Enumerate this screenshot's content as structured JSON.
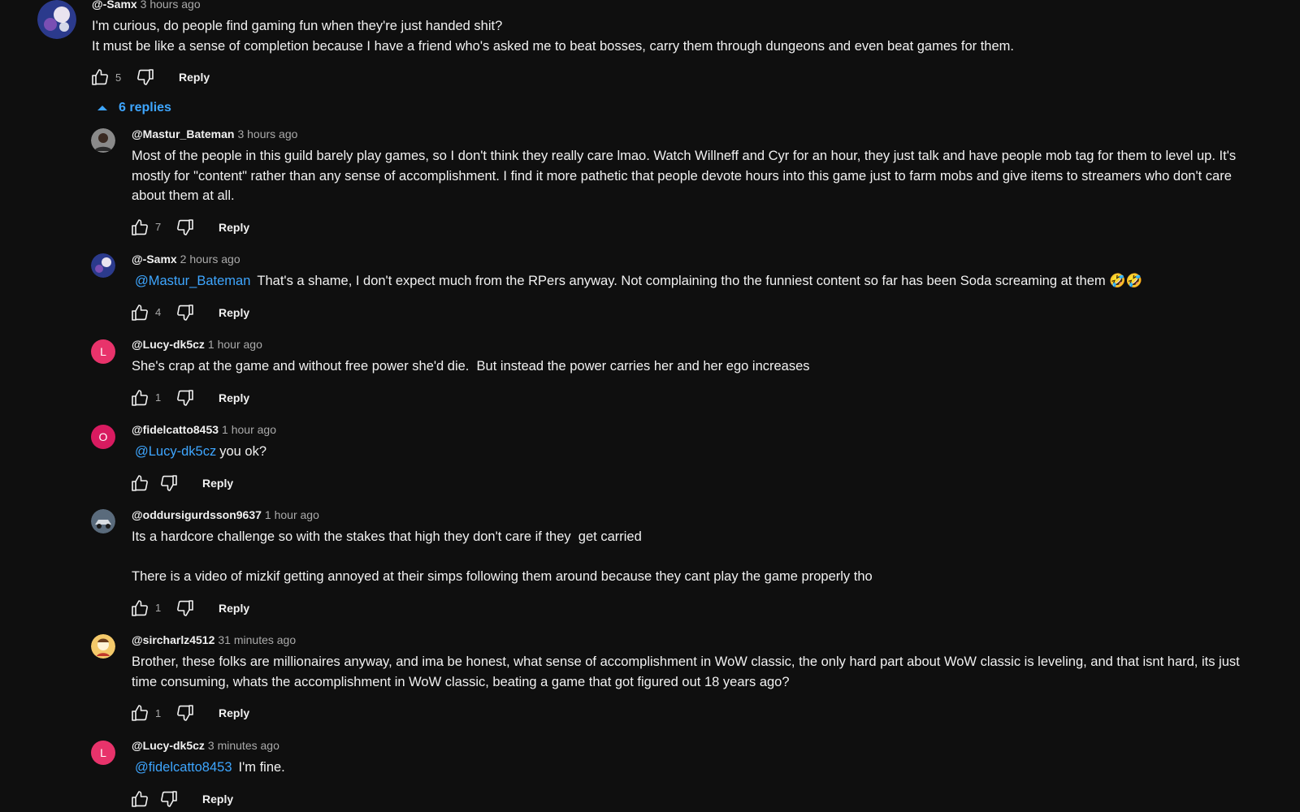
{
  "top_comment": {
    "author": "@-Samx",
    "time": "3 hours ago",
    "text": "I'm curious, do people find gaming fun when they're just handed shit?\nIt must be like a sense of completion because I have a friend who's asked me to beat bosses, carry them through dungeons and even beat games for them.",
    "likes": "5",
    "reply_label": "Reply",
    "avatar_icon": "space-avatar-icon"
  },
  "replies_toggle": {
    "label": "6 replies",
    "icon": "caret-up-icon"
  },
  "replies": [
    {
      "author": "@Mastur_Bateman",
      "time": "3 hours ago",
      "mention": "",
      "text": "Most of the people in this guild barely play games, so I don't think they really care lmao. Watch Willneff and Cyr for an hour, they just talk and have people mob tag for them to level up. It's mostly for \"content\" rather than any sense of accomplishment. I find it more pathetic that people devote hours into this game just to farm mobs and give items to streamers who don't care about them at all.",
      "likes": "7",
      "reply_label": "Reply",
      "avatar_icon": "person-avatar-icon"
    },
    {
      "author": "@-Samx",
      "time": "2 hours ago",
      "mention": "@Mastur_Bateman",
      "text": "That's a shame, I don't expect much from the RPers anyway. Not complaining tho the funniest content so far has been Soda screaming at them 🤣🤣",
      "likes": "4",
      "reply_label": "Reply",
      "avatar_icon": "space-avatar-icon"
    },
    {
      "author": "@Lucy-dk5cz",
      "time": "1 hour ago",
      "mention": "",
      "text": "She's crap at the game and without free power she'd die.  But instead the power carries her and her ego increases",
      "likes": "1",
      "reply_label": "Reply",
      "avatar_letter": "L",
      "avatar_color": "#e8336b"
    },
    {
      "author": "@fidelcatto8453",
      "time": "1 hour ago",
      "mention": "@Lucy-dk5cz",
      "text": "you ok?",
      "likes": "",
      "reply_label": "Reply",
      "avatar_letter": "O",
      "avatar_color": "#d81b60"
    },
    {
      "author": "@oddursigurdsson9637",
      "time": "1 hour ago",
      "mention": "",
      "text": "Its a hardcore challenge so with the stakes that high they don't care if they  get carried\n\nThere is a video of mizkif getting annoyed at their simps following them around because they cant play the game properly tho",
      "likes": "1",
      "reply_label": "Reply",
      "avatar_icon": "car-avatar-icon"
    },
    {
      "author": "@sircharlz4512",
      "time": "31 minutes ago",
      "mention": "",
      "text": "Brother, these folks are millionaires anyway, and ima be honest, what sense of accomplishment in WoW classic, the only hard part about WoW classic is leveling, and that isnt hard, its just time consuming, whats the accomplishment in WoW classic, beating a game that got figured out 18 years ago?",
      "likes": "1",
      "reply_label": "Reply",
      "avatar_icon": "cartoon-avatar-icon"
    },
    {
      "author": "@Lucy-dk5cz",
      "time": "3 minutes ago",
      "mention": "@fidelcatto8453",
      "text": "I'm fine.",
      "likes": "",
      "reply_label": "Reply",
      "avatar_letter": "L",
      "avatar_color": "#e8336b"
    }
  ],
  "colors": {
    "background": "#0f0f0f",
    "text": "#f1f1f1",
    "muted": "#aaaaaa",
    "link": "#3ea6ff"
  }
}
